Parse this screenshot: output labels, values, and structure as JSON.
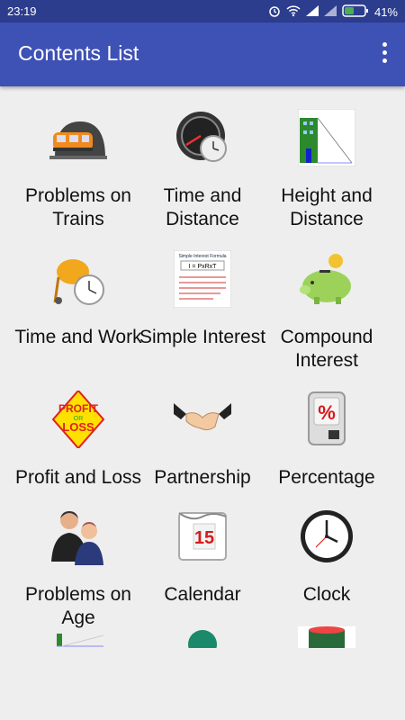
{
  "status": {
    "time": "23:19",
    "battery": "41%"
  },
  "appbar": {
    "title": "Contents List"
  },
  "items": [
    {
      "label": "Problems on Trains"
    },
    {
      "label": "Time and Distance"
    },
    {
      "label": "Height and Distance"
    },
    {
      "label": "Time and Work"
    },
    {
      "label": "Simple Interest"
    },
    {
      "label": "Compound Interest"
    },
    {
      "label": "Profit and Loss"
    },
    {
      "label": "Partnership"
    },
    {
      "label": "Percentage"
    },
    {
      "label": "Problems on Age"
    },
    {
      "label": "Calendar"
    },
    {
      "label": "Clock"
    }
  ],
  "icons": {
    "interest_card_title": "Simple Interest Formula",
    "interest_formula": "I = PxRxT",
    "profit_text": "PROFIT",
    "or_text": "OR",
    "loss_text": "LOSS",
    "calendar_day": "15",
    "percent_sign": "%"
  }
}
